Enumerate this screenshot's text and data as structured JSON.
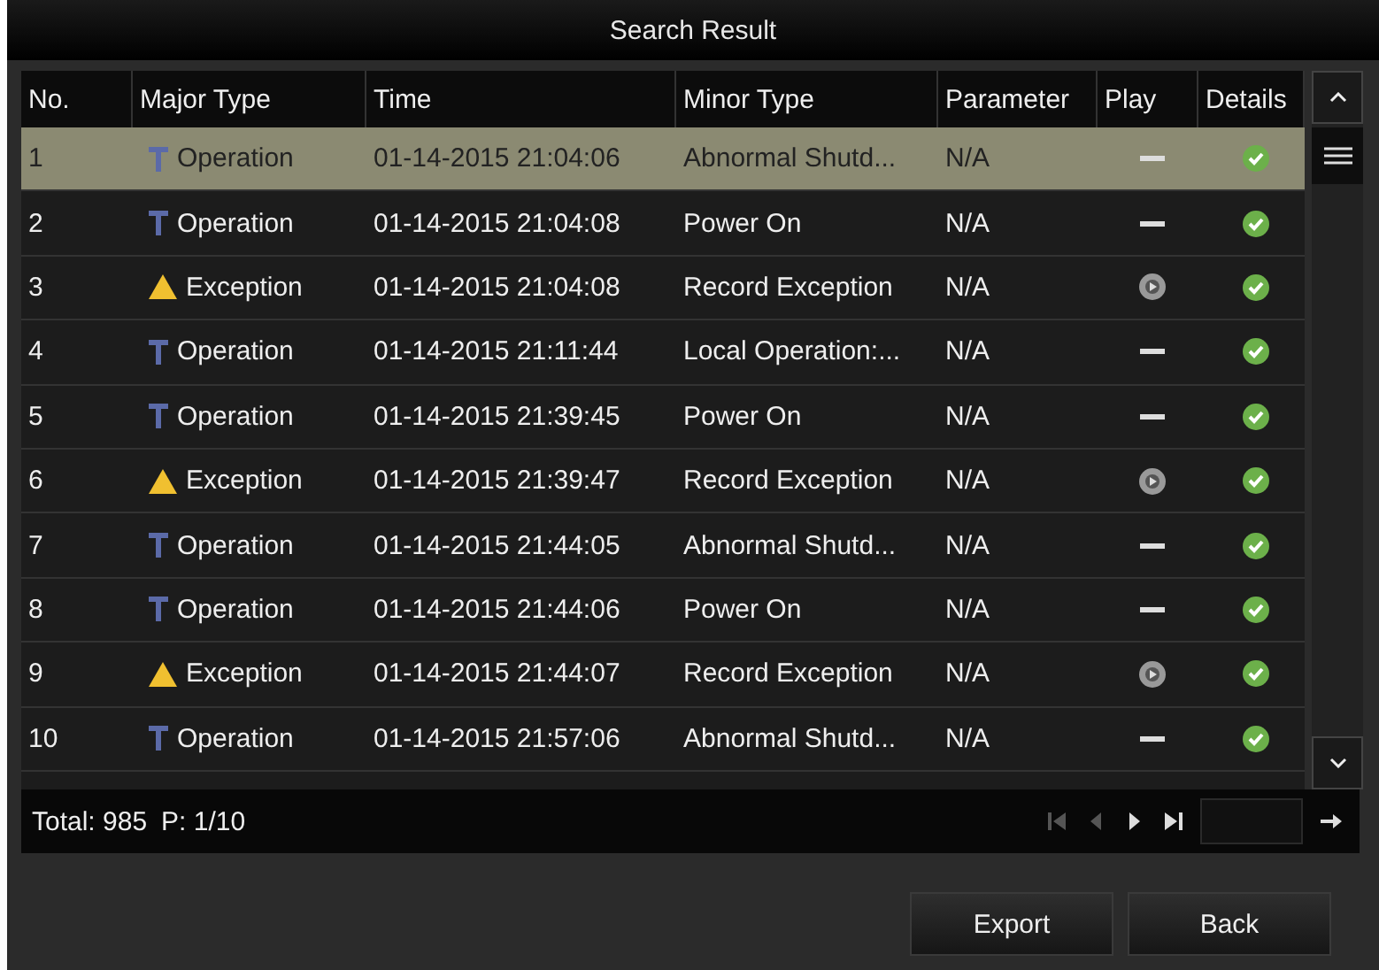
{
  "window": {
    "title": "Search Result"
  },
  "table": {
    "columns": [
      "No.",
      "Major Type",
      "Time",
      "Minor Type",
      "Parameter",
      "Play",
      "Details"
    ],
    "rows": [
      {
        "no": "1",
        "kind": "operation",
        "major_type": "Operation",
        "time": "01-14-2015 21:04:06",
        "minor_type": "Abnormal Shutd...",
        "parameter": "N/A",
        "playable": false,
        "selected": true
      },
      {
        "no": "2",
        "kind": "operation",
        "major_type": "Operation",
        "time": "01-14-2015 21:04:08",
        "minor_type": "Power On",
        "parameter": "N/A",
        "playable": false,
        "selected": false
      },
      {
        "no": "3",
        "kind": "exception",
        "major_type": "Exception",
        "time": "01-14-2015 21:04:08",
        "minor_type": "Record Exception",
        "parameter": "N/A",
        "playable": true,
        "selected": false
      },
      {
        "no": "4",
        "kind": "operation",
        "major_type": "Operation",
        "time": "01-14-2015 21:11:44",
        "minor_type": "Local Operation:...",
        "parameter": "N/A",
        "playable": false,
        "selected": false
      },
      {
        "no": "5",
        "kind": "operation",
        "major_type": "Operation",
        "time": "01-14-2015 21:39:45",
        "minor_type": "Power On",
        "parameter": "N/A",
        "playable": false,
        "selected": false
      },
      {
        "no": "6",
        "kind": "exception",
        "major_type": "Exception",
        "time": "01-14-2015 21:39:47",
        "minor_type": "Record Exception",
        "parameter": "N/A",
        "playable": true,
        "selected": false
      },
      {
        "no": "7",
        "kind": "operation",
        "major_type": "Operation",
        "time": "01-14-2015 21:44:05",
        "minor_type": "Abnormal Shutd...",
        "parameter": "N/A",
        "playable": false,
        "selected": false
      },
      {
        "no": "8",
        "kind": "operation",
        "major_type": "Operation",
        "time": "01-14-2015 21:44:06",
        "minor_type": "Power On",
        "parameter": "N/A",
        "playable": false,
        "selected": false
      },
      {
        "no": "9",
        "kind": "exception",
        "major_type": "Exception",
        "time": "01-14-2015 21:44:07",
        "minor_type": "Record Exception",
        "parameter": "N/A",
        "playable": true,
        "selected": false
      },
      {
        "no": "10",
        "kind": "operation",
        "major_type": "Operation",
        "time": "01-14-2015 21:57:06",
        "minor_type": "Abnormal Shutd...",
        "parameter": "N/A",
        "playable": false,
        "selected": false
      }
    ]
  },
  "status_bar": {
    "total": "Total: 985",
    "page": "P: 1/10",
    "pager": [
      {
        "kind": "first",
        "disabled": true
      },
      {
        "kind": "prev",
        "disabled": true
      },
      {
        "kind": "next",
        "disabled": false
      },
      {
        "kind": "last",
        "disabled": false
      }
    ]
  },
  "buttons": [
    "Export",
    "Back"
  ]
}
